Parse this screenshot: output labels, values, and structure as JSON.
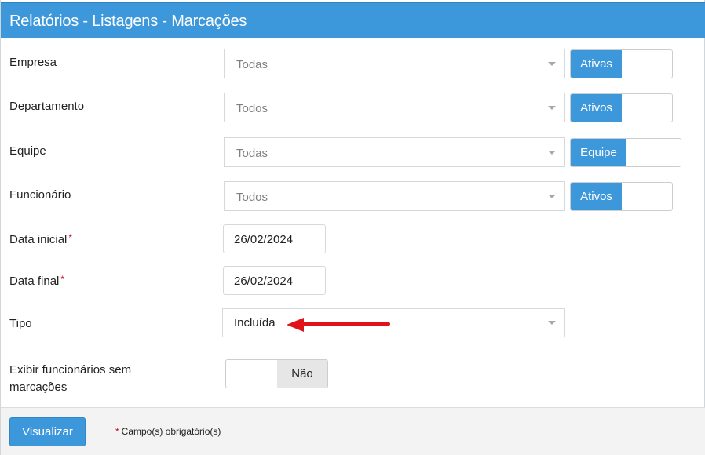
{
  "header": {
    "title": "Relatórios - Listagens - Marcações"
  },
  "fields": {
    "empresa": {
      "label": "Empresa",
      "value": "Todas",
      "toggle_label": "Ativas"
    },
    "departamento": {
      "label": "Departamento",
      "value": "Todos",
      "toggle_label": "Ativos"
    },
    "equipe": {
      "label": "Equipe",
      "value": "Todas",
      "toggle_label": "Equipe"
    },
    "funcionario": {
      "label": "Funcionário",
      "value": "Todos",
      "toggle_label": "Ativos"
    },
    "data_inicial": {
      "label": "Data inicial",
      "required_mark": "*",
      "value": "26/02/2024"
    },
    "data_final": {
      "label": "Data final",
      "required_mark": "*",
      "value": "26/02/2024"
    },
    "tipo": {
      "label": "Tipo",
      "value": "Incluída"
    },
    "exibir": {
      "label_line1": "Exibir funcionários sem",
      "label_line2": "marcações",
      "toggle_label": "Não"
    }
  },
  "footer": {
    "visualizar_label": "Visualizar",
    "required_star": "*",
    "required_note": "Campo(s) obrigatório(s)"
  },
  "colors": {
    "primary": "#3c97db",
    "required": "#d0021b",
    "annotation_arrow": "#e0131b"
  },
  "icons": [
    "chevron-down-icon",
    "red-arrow-annotation"
  ]
}
